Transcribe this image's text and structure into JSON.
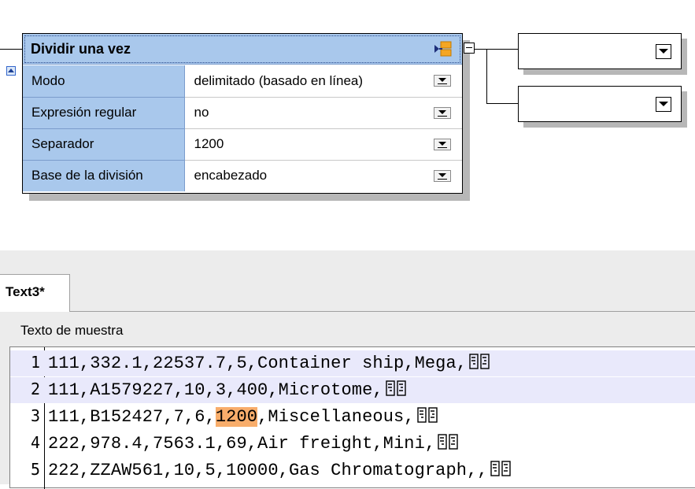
{
  "split_component": {
    "title": "Dividir una vez",
    "properties": [
      {
        "label": "Modo",
        "value": "delimitado (basado en línea)"
      },
      {
        "label": "Expresión regular",
        "value": "no"
      },
      {
        "label": "Separador",
        "value": "1200"
      },
      {
        "label": "Base de la división",
        "value": "encabezado"
      }
    ]
  },
  "targets": [
    {
      "value": ""
    },
    {
      "value": ""
    }
  ],
  "tabs": [
    {
      "label": "Text3*"
    }
  ],
  "sample_group": {
    "title": "Texto de muestra",
    "lines": [
      {
        "num": "1",
        "before": "111,332.1,22537.7,5,Container ship,Mega,",
        "mark": "",
        "after": "",
        "highlight": true
      },
      {
        "num": "2",
        "before": "111,A1579227,10,3,400,Microtome,",
        "mark": "",
        "after": "",
        "highlight": true
      },
      {
        "num": "3",
        "before": "111,B152427,7,6,",
        "mark": "1200",
        "after": ",Miscellaneous,",
        "highlight": false
      },
      {
        "num": "4",
        "before": "222,978.4,7563.1,69,Air freight,Mini,",
        "mark": "",
        "after": "",
        "highlight": false
      },
      {
        "num": "5",
        "before": "222,ZZAW561,10,5,10000,Gas Chromatograph,,",
        "mark": "",
        "after": "",
        "highlight": false
      }
    ]
  },
  "colors": {
    "header_blue": "#a9c8ec",
    "line_highlight": "#e9e9fb",
    "match_highlight": "#f8ad6b",
    "connector_orange": "#f5a623"
  },
  "icons": {
    "header": "split-output-connector-icon",
    "eol": "end-of-line-icon"
  }
}
